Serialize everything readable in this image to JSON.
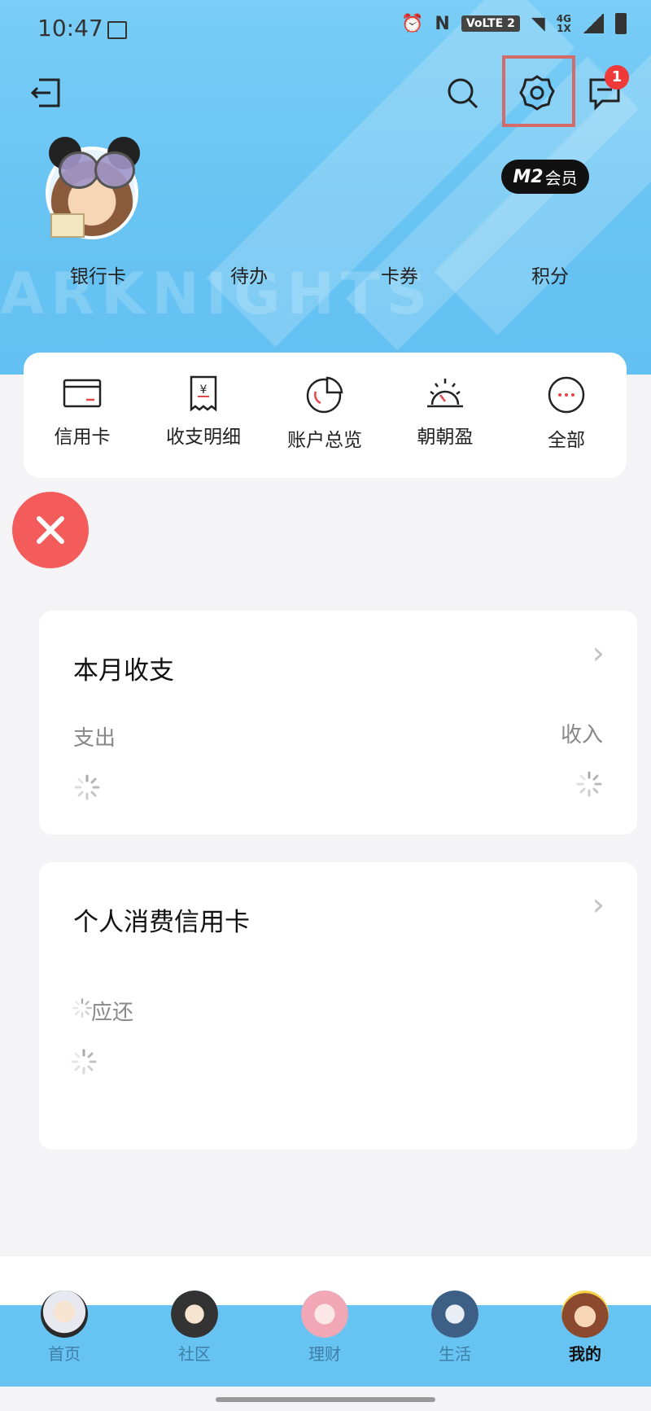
{
  "status_bar": {
    "time": "10:47",
    "volte": "VoLTE 2",
    "network_top": "4G",
    "network_bottom": "1X"
  },
  "header": {
    "badge_count": "1",
    "vip_mark": "M2",
    "vip_label": "会员",
    "stats": [
      "银行卡",
      "待办",
      "卡券",
      "积分"
    ]
  },
  "quick_menu": [
    {
      "label": "信用卡",
      "icon": "credit-card-icon"
    },
    {
      "label": "收支明细",
      "icon": "receipt-icon"
    },
    {
      "label": "账户总览",
      "icon": "pie-chart-icon"
    },
    {
      "label": "朝朝盈",
      "icon": "sunrise-icon"
    },
    {
      "label": "全部",
      "icon": "more-icon"
    }
  ],
  "monthly_card": {
    "title": "本月收支",
    "expense_label": "支出",
    "income_label": "收入"
  },
  "credit_card": {
    "title": "个人消费信用卡",
    "due_label": "应还"
  },
  "tab_bar": {
    "tabs": [
      "首页",
      "社区",
      "理财",
      "生活",
      "我的"
    ],
    "active": "我的"
  },
  "colors": {
    "header_blue": "#6cc6f4",
    "accent_red": "#f45b5b",
    "badge_red": "#f03a3a"
  }
}
